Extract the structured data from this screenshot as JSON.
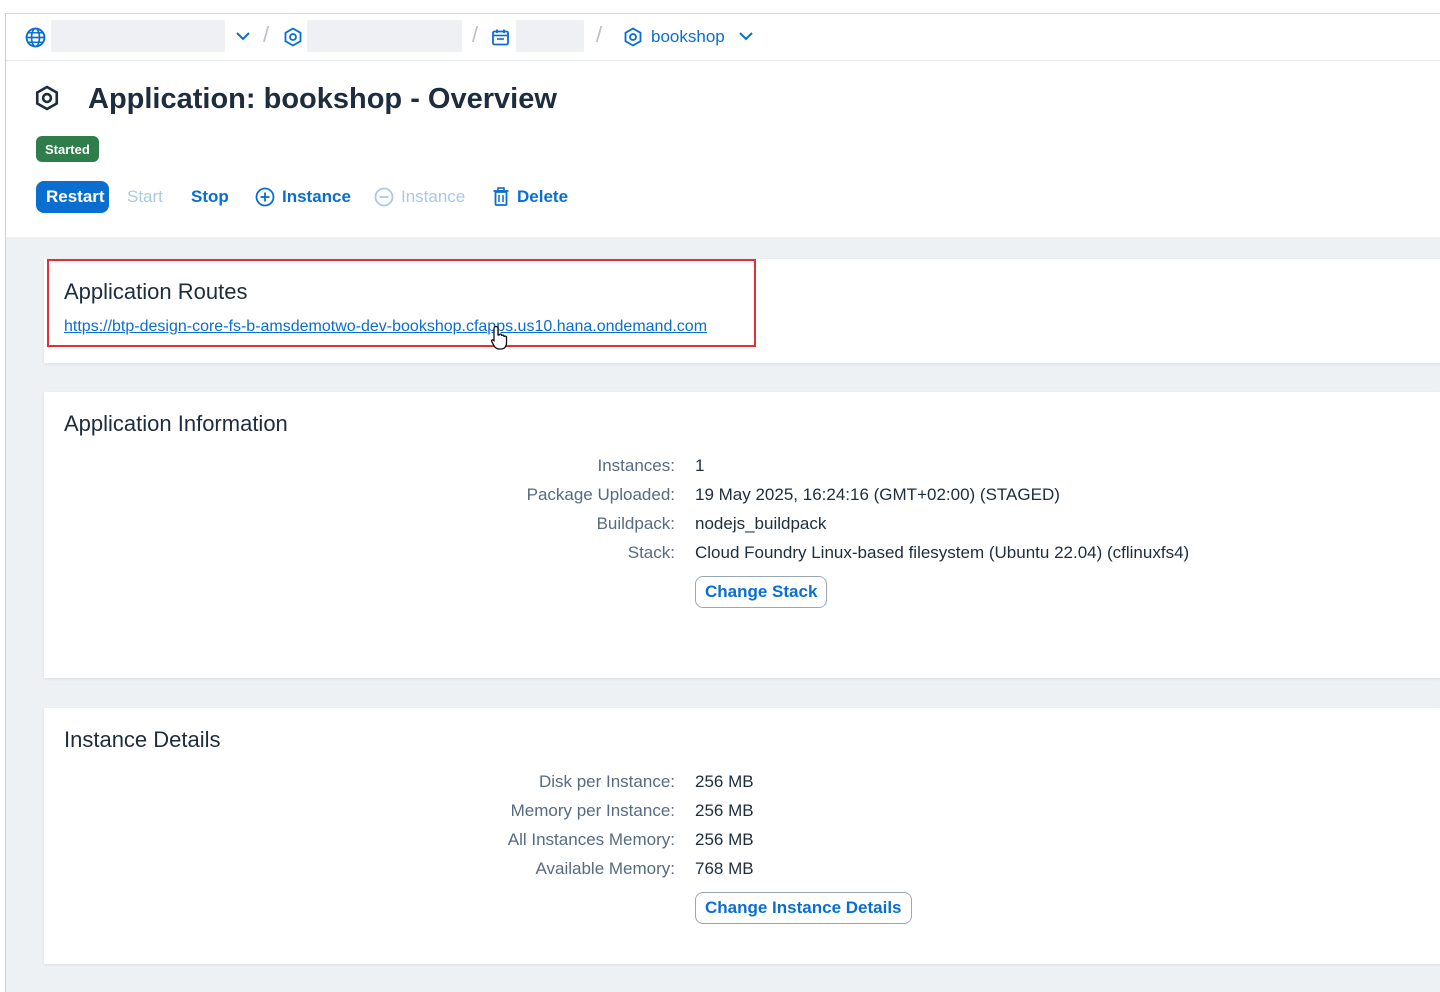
{
  "breadcrumb": {
    "last_label": "bookshop"
  },
  "page": {
    "title": "Application: bookshop - Overview",
    "status": "Started"
  },
  "toolbar": {
    "restart": "Restart",
    "start": "Start",
    "stop": "Stop",
    "add_instance": "Instance",
    "remove_instance": "Instance",
    "delete": "Delete"
  },
  "routes": {
    "title": "Application Routes",
    "url": "https://btp-design-core-fs-b-amsdemotwo-dev-bookshop.cfapps.us10.hana.ondemand.com"
  },
  "app_info": {
    "title": "Application Information",
    "rows": [
      {
        "label": "Instances:",
        "value": "1"
      },
      {
        "label": "Package Uploaded:",
        "value": "19 May 2025, 16:24:16 (GMT+02:00) (STAGED)"
      },
      {
        "label": "Buildpack:",
        "value": "nodejs_buildpack"
      },
      {
        "label": "Stack:",
        "value": "Cloud Foundry Linux-based filesystem (Ubuntu 22.04) (cflinuxfs4)"
      }
    ],
    "button": "Change Stack"
  },
  "instance_details": {
    "title": "Instance Details",
    "rows": [
      {
        "label": "Disk per Instance:",
        "value": "256 MB"
      },
      {
        "label": "Memory per Instance:",
        "value": "256 MB"
      },
      {
        "label": "All Instances Memory:",
        "value": "256 MB"
      },
      {
        "label": "Available Memory:",
        "value": "768 MB"
      }
    ],
    "button": "Change Instance Details"
  },
  "colors": {
    "accent": "#0a6ed1",
    "status_green": "#2e7d4b",
    "highlight_red": "#e0303a"
  }
}
